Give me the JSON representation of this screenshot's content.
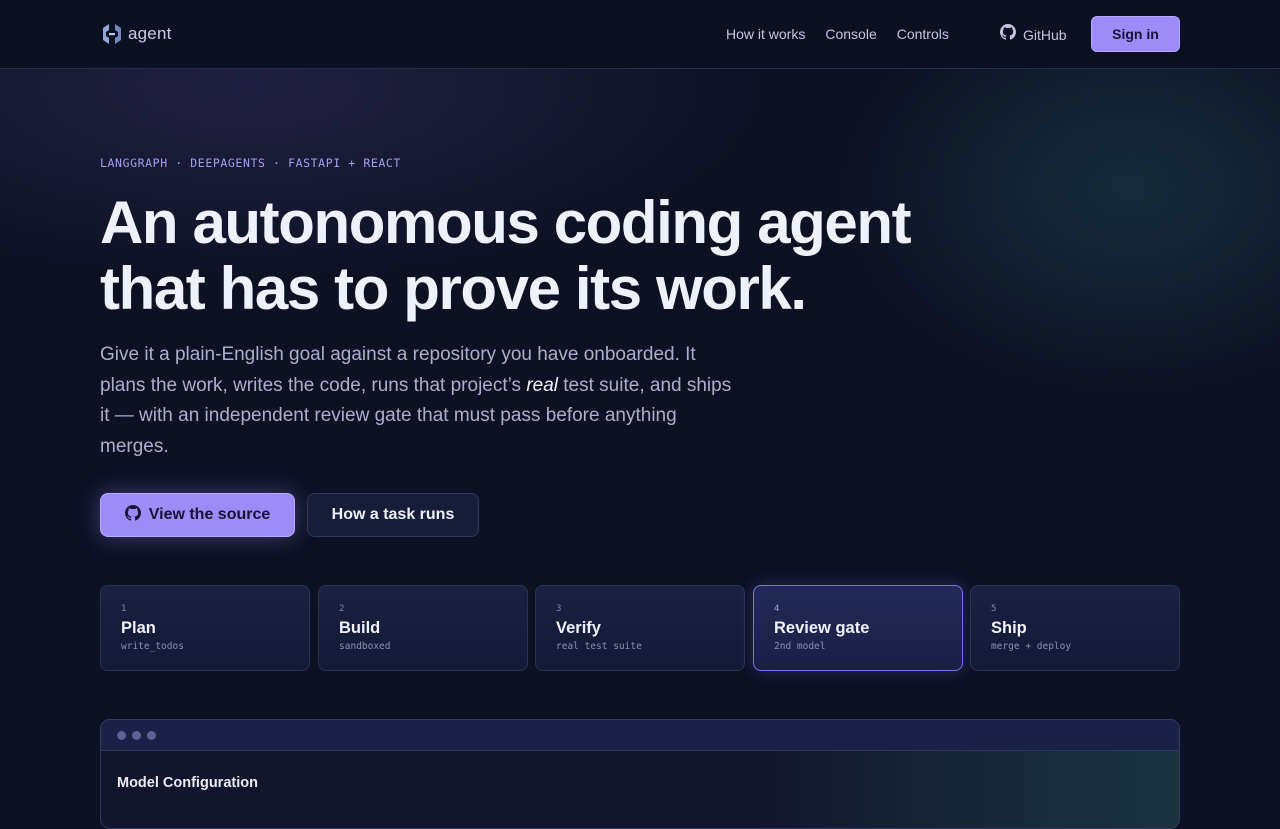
{
  "header": {
    "logo_text": "agent",
    "nav": [
      "How it works",
      "Console",
      "Controls"
    ],
    "github_label": "GitHub",
    "signin_label": "Sign in"
  },
  "hero": {
    "eyebrow": "LANGGRAPH · DEEPAGENTS · FASTAPI + REACT",
    "title_line1": "An autonomous coding agent",
    "title_line2": "that has to prove its work.",
    "desc_part1": "Give it a plain-English goal against a repository you have onboarded. It plans the work, writes the code, runs that project’s ",
    "desc_emphasis": "real",
    "desc_part2": " test suite, and ships it — with an independent review gate that must pass before anything merges.",
    "primary_button": "View the source",
    "secondary_button": "How a task runs"
  },
  "steps": [
    {
      "num": "1",
      "name": "Plan",
      "sub": "write_todos",
      "active": false
    },
    {
      "num": "2",
      "name": "Build",
      "sub": "sandboxed",
      "active": false
    },
    {
      "num": "3",
      "name": "Verify",
      "sub": "real test suite",
      "active": false
    },
    {
      "num": "4",
      "name": "Review gate",
      "sub": "2nd model",
      "active": true
    },
    {
      "num": "5",
      "name": "Ship",
      "sub": "merge + deploy",
      "active": false
    }
  ],
  "preview": {
    "title": "Model Configuration"
  },
  "colors": {
    "background": "#0d1124",
    "accent": "#9d8cf7",
    "active_border": "#7d6ef0"
  }
}
